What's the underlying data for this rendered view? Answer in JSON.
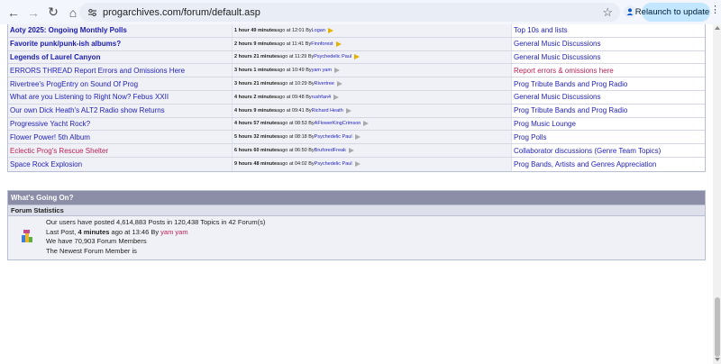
{
  "browser": {
    "url": "progarchives.com/forum/default.asp",
    "relaunch_label": "Relaunch to update",
    "back_glyph": "←",
    "forward_glyph": "→",
    "reload_glyph": "↻",
    "home_glyph": "⌂",
    "star_glyph": "☆",
    "menu_glyph": "⋮"
  },
  "topics": [
    {
      "title": "Aoty 2025: Ongoing Monthly Polls",
      "bold": true,
      "pink": false,
      "time": "1 hour 49 minutes",
      "ago": " ago at 12:01 By ",
      "user": "Logan",
      "arrow": "gold",
      "forum": "Top 10s and lists",
      "forum_pink": false
    },
    {
      "title": "Favorite punk/punk-ish albums?",
      "bold": true,
      "pink": false,
      "time": "2 hours 9 minutes",
      "ago": " ago at 11:41 By ",
      "user": "Finnforest",
      "arrow": "gold",
      "forum": "General Music Discussions",
      "forum_pink": false
    },
    {
      "title": "Legends of Laurel Canyon",
      "bold": true,
      "pink": false,
      "time": "2 hours 21 minutes",
      "ago": " ago at 11:29 By ",
      "user": "Psychedelic Paul",
      "arrow": "gold",
      "forum": "General Music Discussions",
      "forum_pink": false
    },
    {
      "title": "ERRORS THREAD Report Errors and Omissions Here",
      "bold": false,
      "pink": false,
      "time": "3 hours 1 minutes",
      "ago": " ago at 10:49 By ",
      "user": "yam yam",
      "arrow": "grey",
      "forum": "Report errors & omissions here",
      "forum_pink": true
    },
    {
      "title": "Rivertree's ProgEntry on Sound Of Prog",
      "bold": false,
      "pink": false,
      "time": "3 hours 21 minutes",
      "ago": " ago at 10:29 By ",
      "user": "Rivertree",
      "arrow": "grey",
      "forum": "Prog Tribute Bands and Prog Radio",
      "forum_pink": false
    },
    {
      "title": "What are you Listening to Right Now? Febus XXII",
      "bold": false,
      "pink": false,
      "time": "4 hours 2 minutes",
      "ago": " ago at 09:48 By ",
      "user": "rushfan4",
      "arrow": "grey",
      "forum": "General Music Discussions",
      "forum_pink": false
    },
    {
      "title": "Our own Dick Heath's ALT2 Radio show Returns",
      "bold": false,
      "pink": false,
      "time": "4 hours 9 minutes",
      "ago": " ago at 09:41 By ",
      "user": "Richard Heath",
      "arrow": "grey",
      "forum": "Prog Tribute Bands and Prog Radio",
      "forum_pink": false
    },
    {
      "title": "Progressive Yacht Rock?",
      "bold": false,
      "pink": false,
      "time": "4 hours 57 minutes",
      "ago": " ago at 08:53 By ",
      "user": "AFlowerKingCrimson",
      "arrow": "grey",
      "forum": "Prog Music Lounge",
      "forum_pink": false
    },
    {
      "title": "Flower Power! 5th Album",
      "bold": false,
      "pink": false,
      "time": "5 hours 32 minutes",
      "ago": " ago at 08:18 By ",
      "user": "Psychedelic Paul",
      "arrow": "grey",
      "forum": "Prog Polls",
      "forum_pink": false
    },
    {
      "title": "Eclectic Prog's Rescue Shelter",
      "bold": false,
      "pink": true,
      "time": "6 hours 60 minutes",
      "ago": " ago at 06:50 By ",
      "user": "BruforedFreak",
      "arrow": "grey",
      "forum": "Collaborator discussions (Genre Team Topics)",
      "forum_pink": false
    },
    {
      "title": "Space Rock Explosion",
      "bold": false,
      "pink": false,
      "time": "9 hours 48 minutes",
      "ago": " ago at 04:02 By ",
      "user": "Psychedelic Paul",
      "arrow": "grey",
      "forum": "Prog Bands, Artists and Genres Appreciation",
      "forum_pink": false
    }
  ],
  "whats_going_on": {
    "title": "What's Going On?",
    "subtitle": "Forum Statistics",
    "line1": "Our users have posted 4,614,883 Posts in 120,438 Topics in 42 Forum(s)",
    "line2_prefix": "Last Post, ",
    "line2_bold": "4 minutes",
    "line2_mid": " ago at 13:46 By ",
    "line2_user": "yam yam",
    "line3": "We have 70,903 Forum Members",
    "line4": "The Newest Forum Member is"
  }
}
